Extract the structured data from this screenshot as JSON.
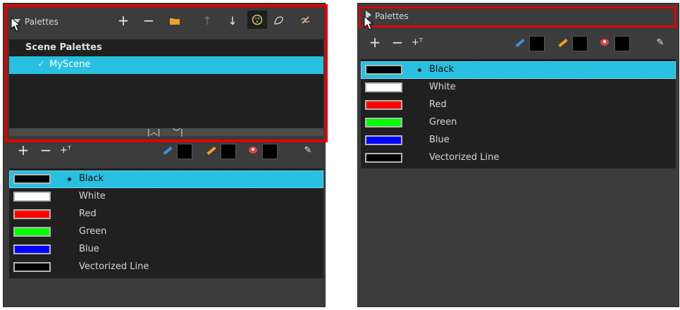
{
  "left_panel": {
    "title": "Palettes",
    "toolbar_icons": [
      "add-icon",
      "remove-icon",
      "folder-icon",
      "move-up-icon",
      "move-down-icon",
      "palette-browser-icon",
      "color-picker-icon",
      "edit-icon"
    ],
    "palette_list": {
      "heading": "Scene Palettes",
      "items": [
        {
          "name": "MyScene",
          "checked": true
        }
      ]
    }
  },
  "right_panel": {
    "title": "Palettes"
  },
  "colors": [
    {
      "name": "Black",
      "hex": "#000000",
      "selected": true
    },
    {
      "name": "White",
      "hex": "#ffffff",
      "selected": false
    },
    {
      "name": "Red",
      "hex": "#ff0000",
      "selected": false
    },
    {
      "name": "Green",
      "hex": "#00ff00",
      "selected": false
    },
    {
      "name": "Blue",
      "hex": "#0000ff",
      "selected": false
    },
    {
      "name": "Vectorized Line",
      "hex": "#000000",
      "selected": false
    }
  ],
  "accent": {
    "highlight": "#28c0e0",
    "annotation_frame": "#e00000"
  }
}
